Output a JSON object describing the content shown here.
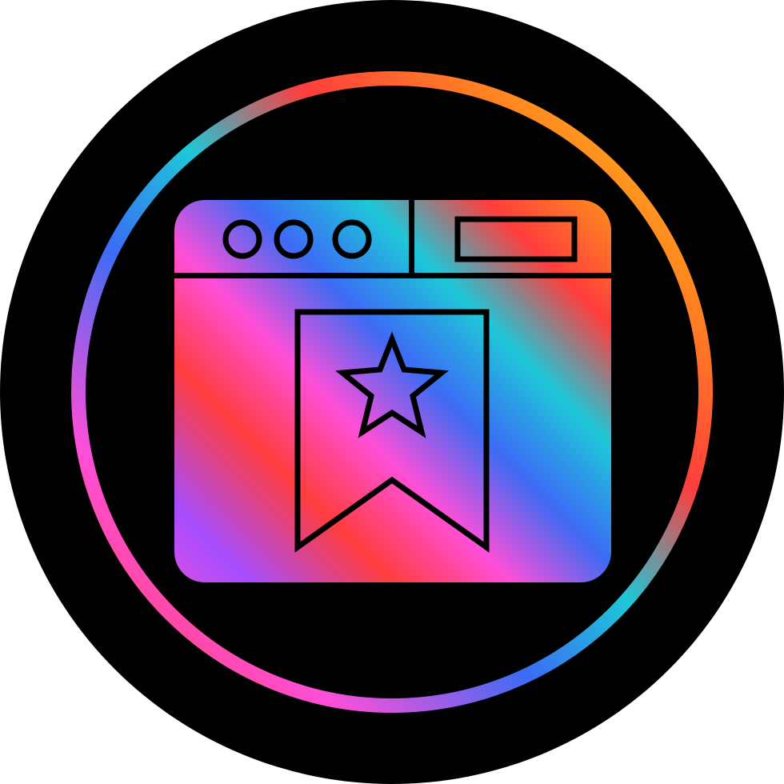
{
  "icon": {
    "name": "web-bookmark-icon",
    "style": "gradient-glyph",
    "background": "#000000",
    "gradient_stops": [
      "#ff3d3d",
      "#ff8a1f",
      "#ffd21f",
      "#30d158",
      "#1ec8d8",
      "#3b6cf5",
      "#a64dff",
      "#ff4fd8",
      "#ff3d3d"
    ]
  }
}
